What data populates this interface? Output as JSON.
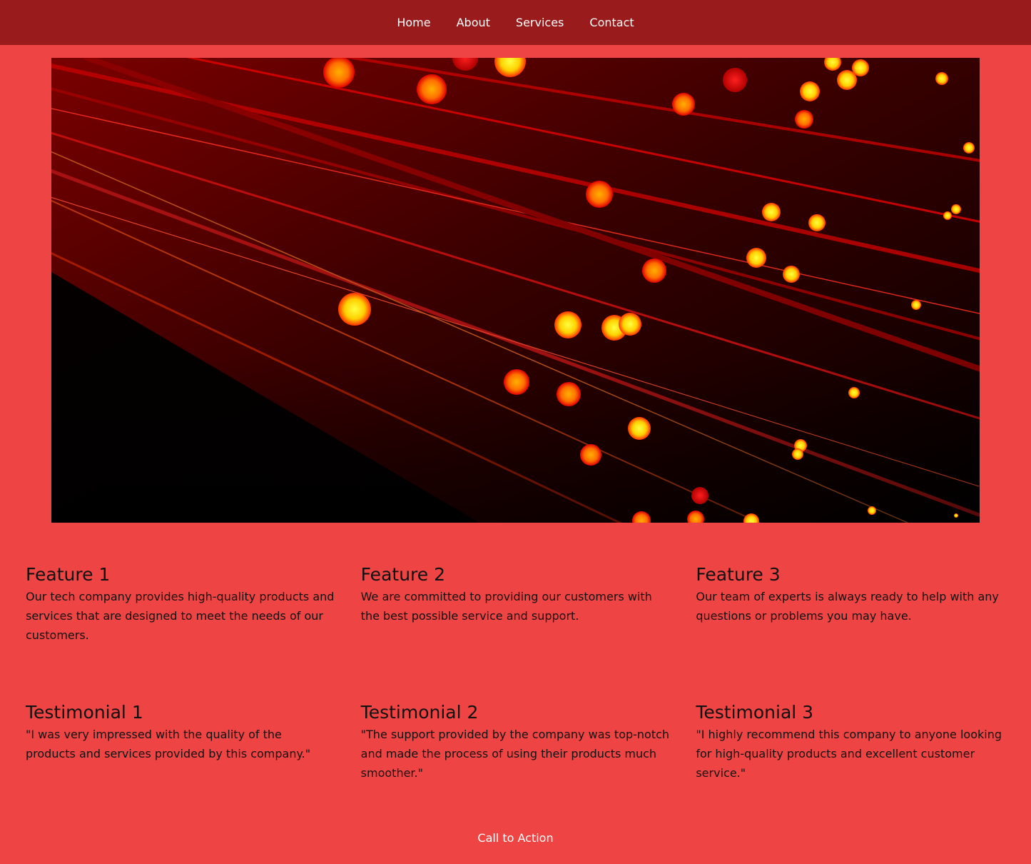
{
  "nav": {
    "items": [
      {
        "label": "Home"
      },
      {
        "label": "About"
      },
      {
        "label": "Services"
      },
      {
        "label": "Contact"
      }
    ]
  },
  "hero": {
    "image_name": "fiber-optic-lights-image"
  },
  "features": [
    {
      "title": "Feature 1",
      "text": "Our tech company provides high-quality products and services that are designed to meet the needs of our customers."
    },
    {
      "title": "Feature 2",
      "text": "We are committed to providing our customers with the best possible service and support."
    },
    {
      "title": "Feature 3",
      "text": "Our team of experts is always ready to help with any questions or problems you may have."
    }
  ],
  "testimonials": [
    {
      "title": "Testimonial 1",
      "text": "\"I was very impressed with the quality of the products and services provided by this company.\""
    },
    {
      "title": "Testimonial 2",
      "text": "\"The support provided by the company was top-notch and made the process of using their products much smoother.\""
    },
    {
      "title": "Testimonial 3",
      "text": "\"I highly recommend this company to anyone looking for high-quality products and excellent customer service.\""
    }
  ],
  "cta": {
    "label": "Call to Action"
  },
  "colors": {
    "page_background": "#ef4444",
    "navbar_background": "#991b1b",
    "nav_text": "#ffffff",
    "body_text": "#111111"
  }
}
